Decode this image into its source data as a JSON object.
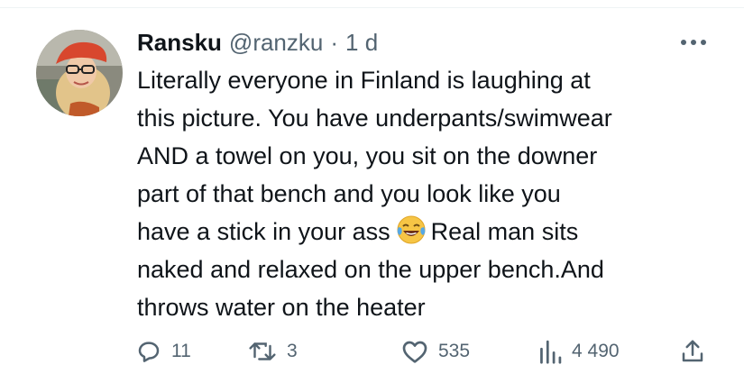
{
  "tweet": {
    "display_name": "Ransku",
    "handle": "@ranzku",
    "separator": "·",
    "time": "1 d",
    "more_icon": "more-horizontal-icon",
    "avatar_alt": "profile-photo",
    "text_lines": [
      "Literally everyone in Finland is laughing at",
      "this picture. You have underpants/swimwear",
      "AND a towel on you, you sit on the downer",
      "part of that bench and you look like you",
      "have a stick in your ass",
      "Real man sits",
      "naked and relaxed on the upper bench.And",
      "throws water on the heater"
    ],
    "emoji_name": "face-with-tears-of-joy-emoji"
  },
  "actions": {
    "reply_count": "11",
    "retweet_count": "3",
    "like_count": "535",
    "views_count": "4 490",
    "icons": [
      "reply-icon",
      "retweet-icon",
      "like-icon",
      "views-icon",
      "share-icon"
    ]
  },
  "colors": {
    "text_primary": "#0f1419",
    "text_secondary": "#536471",
    "divider": "#eff3f4"
  }
}
